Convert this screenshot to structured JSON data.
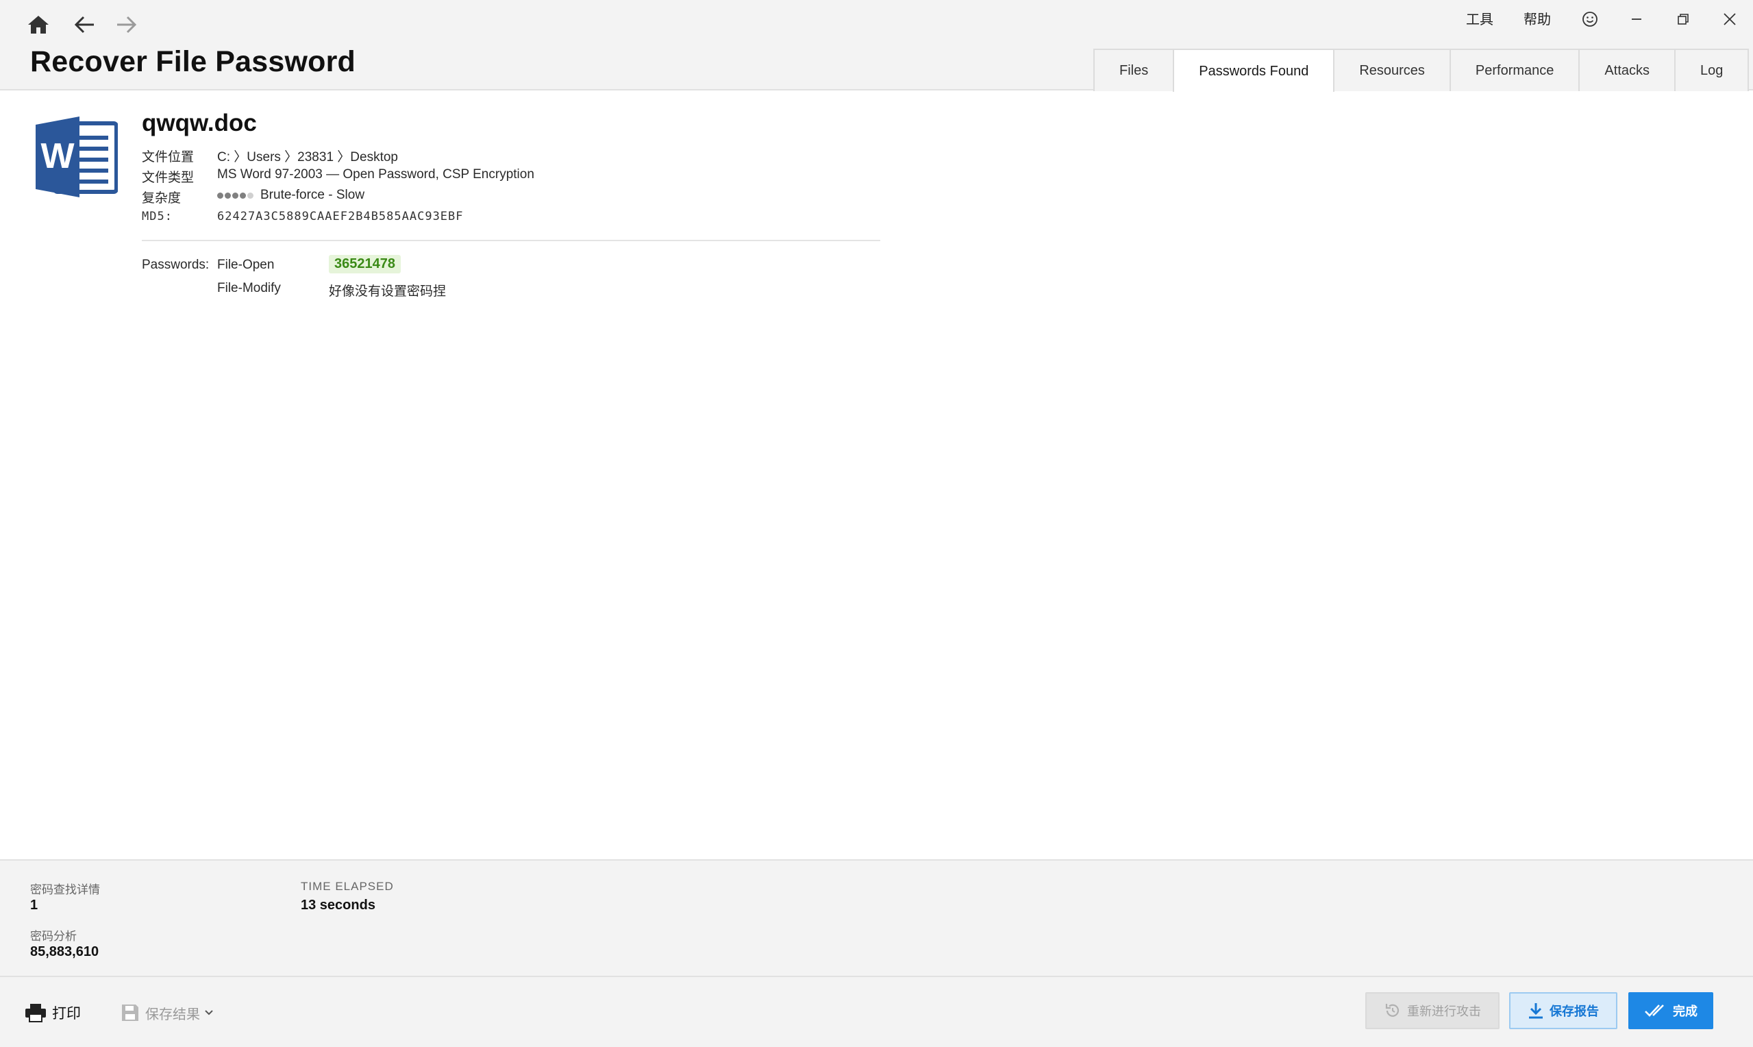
{
  "nav": {
    "home_icon": "home-icon",
    "back_icon": "arrow-left-icon",
    "forward_icon": "arrow-right-icon"
  },
  "header": {
    "title": "Recover File Password",
    "menu": {
      "tools": "工具",
      "help": "帮助"
    },
    "window_buttons": [
      "smiley-icon",
      "minimize-icon",
      "restore-icon",
      "close-icon"
    ]
  },
  "tabs": [
    {
      "label": "Files",
      "active": false
    },
    {
      "label": "Passwords Found",
      "active": true
    },
    {
      "label": "Resources",
      "active": false
    },
    {
      "label": "Performance",
      "active": false
    },
    {
      "label": "Attacks",
      "active": false
    },
    {
      "label": "Log",
      "active": false
    }
  ],
  "file": {
    "name": "qwqw.doc",
    "icon": "word-document-icon",
    "location_label": "文件位置",
    "location": "C: 〉Users 〉23831 〉Desktop",
    "type_label": "文件类型",
    "type": "MS Word 97-2003 — Open Password, CSP Encryption",
    "complexity_label": "复杂度",
    "complexity_level": 4,
    "complexity_max": 5,
    "complexity": "Brute-force - Slow",
    "md5_label": "MD5:",
    "md5": "62427A3C5889CAAEF2B4B585AAC93EBF"
  },
  "passwords": {
    "label": "Passwords:",
    "items": [
      {
        "type": "File-Open",
        "value": "36521478"
      },
      {
        "type": "File-Modify",
        "value": "好像没有设置密码捏"
      }
    ]
  },
  "stats": {
    "found_label": "密码查找详情",
    "found_value": "1",
    "tested_label": "密码分析",
    "tested_value": "85,883,610",
    "time_label": "TIME ELAPSED",
    "time_value": "13 seconds"
  },
  "actions": {
    "print": "打印",
    "save_results": "保存结果",
    "restart": "重新进行攻击",
    "save_report": "保存报告",
    "done": "完成"
  },
  "colors": {
    "accent": "#1e88e5",
    "password_green": "#3a8a16",
    "word_blue": "#2b579a"
  }
}
